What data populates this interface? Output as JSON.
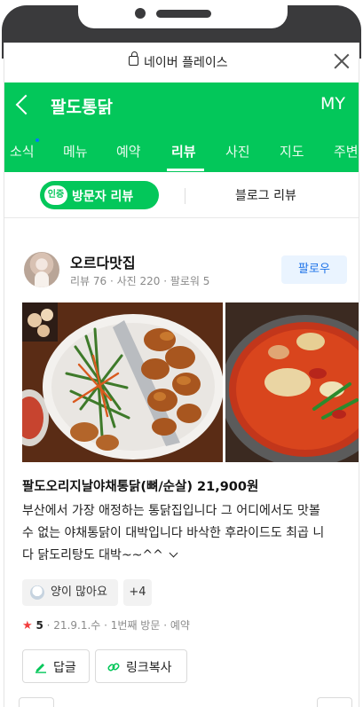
{
  "browser": {
    "title": "네이버 플레이스"
  },
  "header": {
    "place_name": "팔도통닭",
    "my_label": "MY"
  },
  "tabs": [
    {
      "label": "소식"
    },
    {
      "label": "메뉴"
    },
    {
      "label": "예약"
    },
    {
      "label": "리뷰"
    },
    {
      "label": "사진"
    },
    {
      "label": "지도"
    },
    {
      "label": "주변"
    }
  ],
  "subtabs": {
    "cert_badge": "인증",
    "visitor": "방문자 리뷰",
    "blog": "블로그 리뷰"
  },
  "review": {
    "user_name": "오르다맛집",
    "user_stats": "리뷰 76 · 사진 220 · 팔로워 5",
    "follow_label": "팔로우",
    "menu_title": "팔도오리지날야채통닭(뼈/순살) 21,900원",
    "body_lines": [
      "부산에서 가장 애정하는 통닭집입니다 그 어디에서도 맛볼",
      "수 없는 야채통닭이 대박입니다 바삭한 후라이드도 최곱 니",
      "다 닭도리탕도 대박~~^^"
    ],
    "chip_label": "양이 많아요",
    "chip_more": "+4",
    "rating_star": "★",
    "rating": "5",
    "visit_info": "· 21.9.1.수 · 1번째 방문 · 예약",
    "reply_label": "답글",
    "copy_link_label": "링크복사"
  },
  "colors": {
    "brand_green": "#03c75a",
    "follow_blue": "#1e73e8",
    "star_red": "#f23d3d"
  }
}
